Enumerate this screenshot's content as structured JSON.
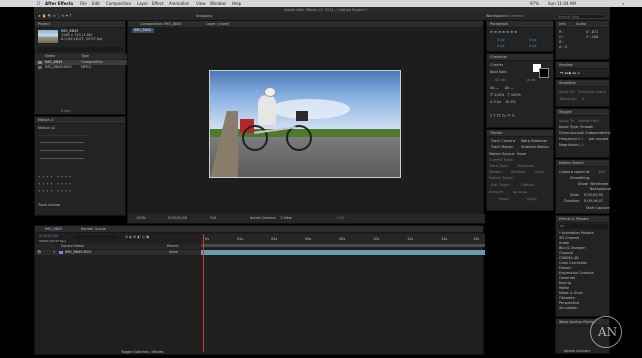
{
  "menubar": {
    "app_name": "After Effects",
    "items": [
      "File",
      "Edit",
      "Composition",
      "Layer",
      "Effect",
      "Animation",
      "View",
      "Window",
      "Help"
    ],
    "window_title": "Adobe After Effects CC 2014 - Untitled Project *",
    "battery": "97%",
    "clock": "Sun 11:04 AM",
    "search_label": "Search Help"
  },
  "toolbar": {
    "snapping_label": "Snapping",
    "workspace_label": "Workspace:",
    "workspace_value": "Animation"
  },
  "project": {
    "tab": "Project",
    "item_name": "IMG_8845",
    "item_info1": "1280 x 720 (1.00)",
    "item_info2": "Δ 0;00;16;07, 29.97 fps",
    "item_info3": "Millions of Colors",
    "columns": [
      "Name",
      "Type"
    ],
    "rows": [
      {
        "name": "IMG_8845",
        "type": "Composition"
      },
      {
        "name": "IMG_8845.MOV",
        "type": "MPEG"
      }
    ],
    "bpc": "8 bpc"
  },
  "effect_controls": {
    "tab": "Motion 2",
    "preset_label": "Motion v2",
    "track_button": "Track Anchor"
  },
  "composition": {
    "tab": "Composition: IMG_8845",
    "layer_tab": "Layer: (none)",
    "crumb": "IMG_8845",
    "zoom": "100%",
    "timecode": "0;00;00;00",
    "resolution": "Full",
    "camera": "Active Camera",
    "view_count": "1 View",
    "offset": "+0.0"
  },
  "info_panel": {
    "tab": "Info",
    "audio_tab": "Audio",
    "r": "R :",
    "g": "G :",
    "b": "B :",
    "a": "A : 0",
    "x": "X : 872",
    "y": "Y : 208"
  },
  "preview_panel": {
    "tab": "Preview"
  },
  "paragraph_panel": {
    "tab": "Paragraph",
    "px1": "0 px",
    "px2": "0 px",
    "px3": "0 px",
    "px4": "0 px"
  },
  "character_panel": {
    "tab": "Character",
    "font": "Charter",
    "style": "Bold Italic",
    "size": "52 px",
    "auto": "Auto"
  },
  "tracker_panel": {
    "tab": "Tracker",
    "track_camera": "Track Camera",
    "warp_stabilizer": "Warp Stabilizer",
    "track_motion": "Track Motion",
    "stabilize_motion": "Stabilize Motion",
    "motion_source_label": "Motion Source:",
    "motion_source": "None",
    "current_track_label": "Current Track:",
    "track_type_label": "Track Type:",
    "track_type": "Transform",
    "position": "Position",
    "rotation": "Rotation",
    "scale": "Scale",
    "motion_target": "Motion Target:",
    "edit_target": "Edit Target...",
    "options": "Options...",
    "analyze": "Analyze:",
    "reset": "Reset",
    "apply": "Apply"
  },
  "smoother_panel": {
    "tab": "Smoother",
    "apply_to": "Apply To:",
    "apply_to_value": "Temporal Graph",
    "tolerance_label": "Tolerance:",
    "tolerance": "1"
  },
  "wiggler_panel": {
    "tab": "Wiggler",
    "apply_to": "Apply To:",
    "apply_value": "Spatial Path",
    "noise_type": "Noise Type:",
    "noise_value": "Smooth",
    "dimensions": "Dimensions:",
    "dim_value": "All Independently",
    "frequency": "Frequency:",
    "freq_value": "5.0",
    "freq_unit": "per second",
    "magnitude": "Magnitude:",
    "mag_value": "1.0"
  },
  "motion_sketch": {
    "tab": "Motion Sketch",
    "capture_speed": "Capture speed at:",
    "speed": "100",
    "smoothing": "Smoothing:",
    "show": "Show:",
    "wireframe": "Wireframe",
    "background": "Background",
    "start": "Start:",
    "start_value": "0;00;00;00",
    "duration": "Duration:",
    "duration_value": "0;00;16;07",
    "start_capture": "Start Capture"
  },
  "effects_presets": {
    "tab": "Effects & Presets",
    "search_placeholder": "ρ▾",
    "items": [
      "* Animation Presets",
      "3D Channel",
      "Audio",
      "Blur & Sharpen",
      "Channel",
      "CINEMA 4D",
      "Color Correction",
      "Distort",
      "Expression Controls",
      "Generate",
      "Keying",
      "Matte",
      "Noise & Grain",
      "Obsolete",
      "Perspective",
      "Simulation"
    ]
  },
  "wave_anchor": {
    "tab": "Wave Anchor Points",
    "ignore_label": "Ignore Anchors"
  },
  "timeline": {
    "tab": "IMG_8845",
    "render_tab": "Render Queue",
    "timecode": "0;00;00;00",
    "fps": "00000 (29.97 fps)",
    "col_source": "Source Name",
    "col_parent": "Parent",
    "layer_num": "1",
    "layer_name": "IMG_8845.MOV",
    "parent_value": "None",
    "ruler": [
      "0s",
      "02s",
      "04s",
      "06s",
      "08s",
      "10s",
      "12s",
      "14s",
      "16s"
    ],
    "toggle_label": "Toggle Switches / Modes"
  },
  "watermark_text": "AN"
}
